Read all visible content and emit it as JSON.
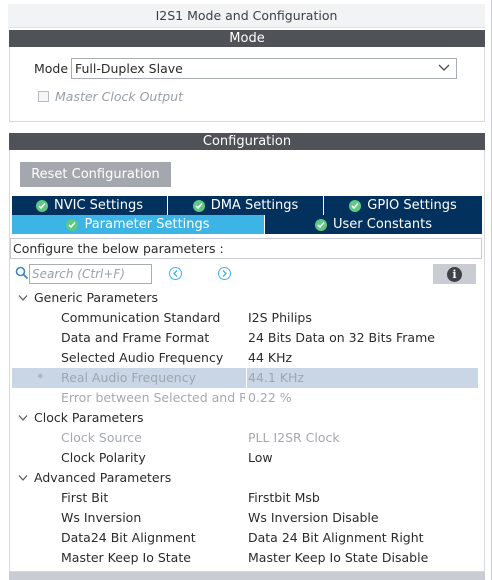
{
  "window": {
    "title": "I2S1 Mode and Configuration"
  },
  "mode_section": {
    "header": "Mode",
    "mode_label": "Mode",
    "mode_value": "Full-Duplex Slave",
    "master_clock_label": "Master Clock Output",
    "master_clock_checked": false
  },
  "config_section": {
    "header": "Configuration",
    "reset_label": "Reset Configuration",
    "tabs": [
      {
        "label": "NVIC Settings",
        "active": false
      },
      {
        "label": "DMA Settings",
        "active": false
      },
      {
        "label": "GPIO Settings",
        "active": false
      },
      {
        "label": "Parameter Settings",
        "active": true
      },
      {
        "label": "User Constants",
        "active": false
      }
    ],
    "configure_text": "Configure the below parameters :",
    "search_placeholder": "Search (Ctrl+F)",
    "groups": [
      {
        "name": "Generic Parameters",
        "params": [
          {
            "name": "Communication Standard",
            "value": "I2S Philips"
          },
          {
            "name": "Data and Frame Format",
            "value": "24 Bits Data on 32 Bits Frame"
          },
          {
            "name": "Selected Audio Frequency",
            "value": "44 KHz"
          },
          {
            "name": "Real Audio Frequency",
            "value": "44.1 KHz",
            "marker": "*"
          },
          {
            "name": "Error between Selected and R...",
            "value": "0.22 %"
          }
        ]
      },
      {
        "name": "Clock Parameters",
        "params": [
          {
            "name": "Clock Source",
            "value": "PLL I2SR Clock"
          },
          {
            "name": "Clock Polarity",
            "value": "Low"
          }
        ]
      },
      {
        "name": "Advanced Parameters",
        "params": [
          {
            "name": "First Bit",
            "value": "Firstbit Msb"
          },
          {
            "name": "Ws Inversion",
            "value": "Ws Inversion Disable"
          },
          {
            "name": "Data24 Bit Alignment",
            "value": "Data 24 Bit Alignment Right"
          },
          {
            "name": "Master Keep Io State",
            "value": "Master Keep Io State Disable"
          }
        ]
      }
    ]
  },
  "colors": {
    "header_bg": "#4f5257",
    "tab_dark": "#02315e",
    "tab_active": "#3cb4e6",
    "check_green": "#5dc982",
    "selected_row": "#c8d6e5"
  }
}
